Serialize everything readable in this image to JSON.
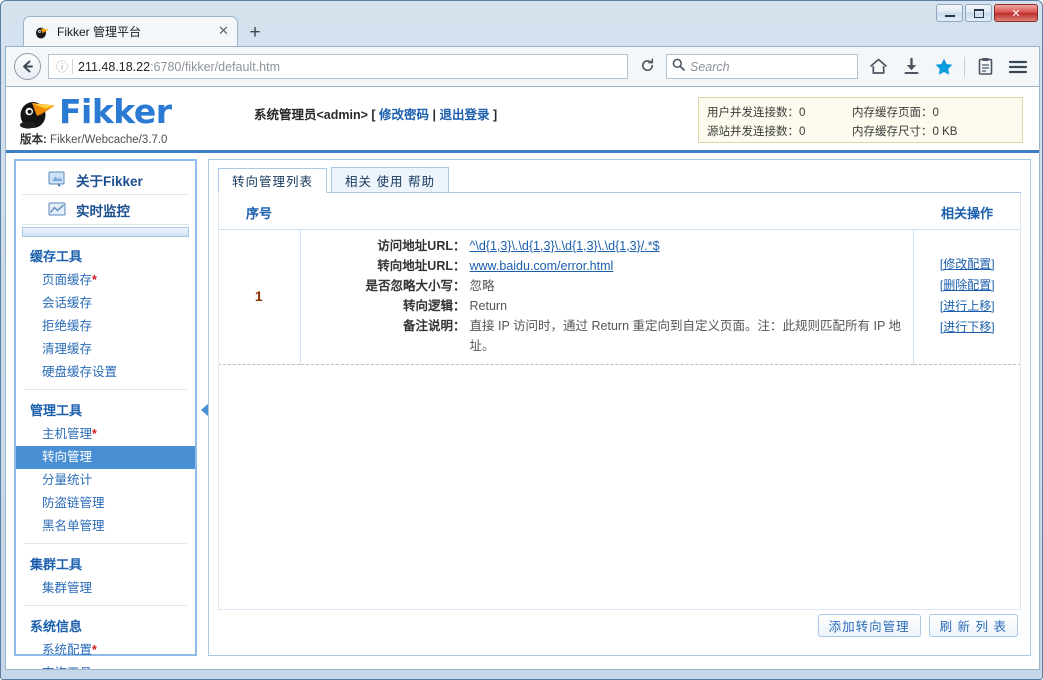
{
  "window": {
    "minimize_label": "minimize",
    "maximize_label": "maximize",
    "close_label": "✕"
  },
  "browser": {
    "tab": {
      "title": "Fikker 管理平台",
      "favicon": "fikker-toucan-icon",
      "close_label": "✕"
    },
    "new_tab_label": "+",
    "back_label": "←",
    "url": {
      "host": "211.48.18.22",
      "rest": ":6780/fikker/default.htm",
      "full": "211.48.18.22:6780/fikker/default.htm",
      "info_icon": "ⓘ"
    },
    "reload_label": "⟳",
    "search": {
      "placeholder": "Search",
      "icon": "search-icon"
    },
    "icons": [
      "home-icon",
      "downloads-icon",
      "bookmark-star-icon",
      "library-icon",
      "menu-hamburger-icon"
    ]
  },
  "site": {
    "logo_text": "Fikker",
    "version_label": "版本:",
    "version_value": "Fikker/Webcache/3.7.0",
    "admin_text": "系统管理员<admin> [ ",
    "admin_change_password": "修改密码",
    "admin_sep": " | ",
    "admin_logout": "退出登录",
    "admin_tail": " ]",
    "stats": [
      {
        "left": "用户并发连接数：0",
        "right": "内存缓存页面：0"
      },
      {
        "left": "源站并发连接数：0",
        "right": "内存缓存尺寸：0 KB"
      }
    ]
  },
  "sidebar": {
    "top_items": [
      {
        "label": "关于Fikker",
        "icon": "about-icon"
      },
      {
        "label": "实时监控",
        "icon": "monitor-icon"
      }
    ],
    "groups": [
      {
        "title": "缓存工具",
        "items": [
          {
            "label": "页面缓存",
            "required": true
          },
          {
            "label": "会话缓存",
            "required": false
          },
          {
            "label": "拒绝缓存",
            "required": false
          },
          {
            "label": "清理缓存",
            "required": false
          },
          {
            "label": "硬盘缓存设置",
            "required": false
          }
        ]
      },
      {
        "title": "管理工具",
        "items": [
          {
            "label": "主机管理",
            "required": true
          },
          {
            "label": "转向管理",
            "required": false,
            "active": true
          },
          {
            "label": "分量统计",
            "required": false
          },
          {
            "label": "防盗链管理",
            "required": false
          },
          {
            "label": "黑名单管理",
            "required": false
          }
        ]
      },
      {
        "title": "集群工具",
        "items": [
          {
            "label": "集群管理",
            "required": false
          }
        ]
      },
      {
        "title": "系统信息",
        "items": [
          {
            "label": "系统配置",
            "required": true
          },
          {
            "label": "查询工具",
            "required": false
          }
        ]
      }
    ],
    "collapse_icon": "collapse-left-arrow-icon"
  },
  "content": {
    "tabs": [
      {
        "label": "转向管理列表",
        "selected": true
      },
      {
        "label": "相关 使用 帮助",
        "selected": false
      }
    ],
    "table": {
      "headers": {
        "index": "序号",
        "actions": "相关操作"
      },
      "rows": [
        {
          "index": "1",
          "fields": [
            {
              "key": "访问地址URL：",
              "value": "^\\d{1,3}\\.\\d{1,3}\\.\\d{1,3}\\.\\d{1,3}/.*$",
              "link": true
            },
            {
              "key": "转向地址URL：",
              "value": "www.baidu.com/error.html",
              "link": true
            },
            {
              "key": "是否忽略大小写：",
              "value": "忽略",
              "link": false
            },
            {
              "key": "转向逻辑：",
              "value": "Return",
              "link": false
            },
            {
              "key": "备注说明：",
              "value": "直接 IP 访问时，通过 Return 重定向到自定义页面。注：此规则匹配所有 IP 地址。",
              "link": false
            }
          ],
          "actions": [
            "[修改配置]",
            "[删除配置]",
            "[进行上移]",
            "[进行下移]"
          ]
        }
      ]
    },
    "buttons": [
      {
        "label": "添加转向管理"
      },
      {
        "label": "刷 新 列 表"
      }
    ]
  }
}
